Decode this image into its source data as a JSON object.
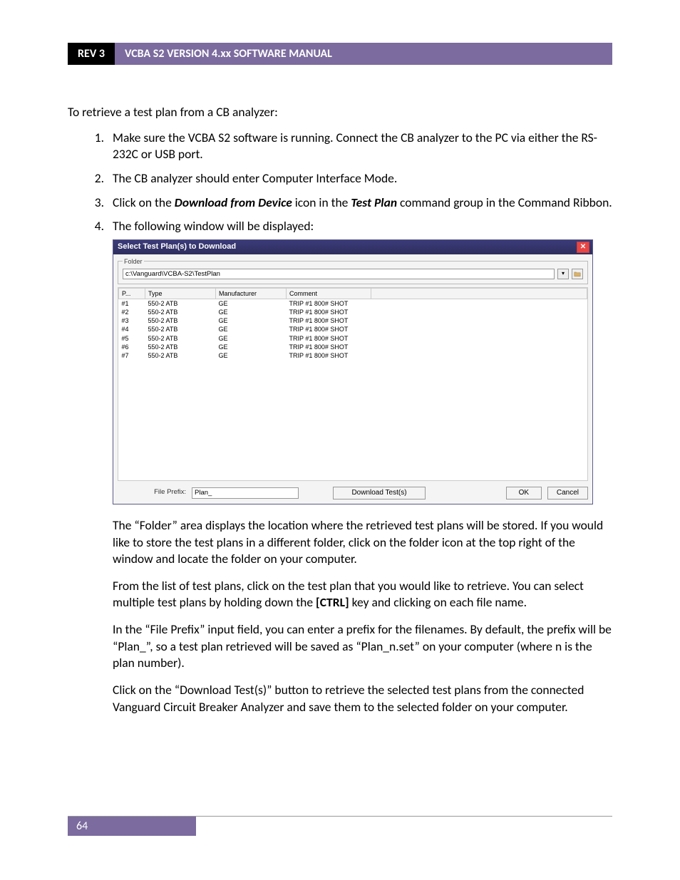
{
  "header": {
    "rev": "REV 3",
    "title": "VCBA S2 VERSION 4.xx SOFTWARE MANUAL"
  },
  "intro": "To retrieve a test plan from a CB analyzer:",
  "steps": {
    "s1": "Make sure the VCBA S2 software is running. Connect the CB analyzer to the PC via either the RS-232C or USB port.",
    "s2": "The CB analyzer should enter Computer Interface Mode.",
    "s3_a": "Click on the ",
    "s3_b": "Download from Device",
    "s3_c": " icon in the ",
    "s3_d": "Test Plan",
    "s3_e": " command group in the Command Ribbon.",
    "s4": "The following window will be displayed:"
  },
  "dialog": {
    "title": "Select Test Plan(s) to Download",
    "folder_legend": "Folder",
    "folder_path": "c:\\Vanguard\\VCBA-S2\\TestPlan",
    "columns": {
      "p": "P...",
      "type": "Type",
      "mfg": "Manufacturer",
      "comment": "Comment"
    },
    "rows": [
      {
        "p": "#1",
        "type": "550-2 ATB",
        "mfg": "GE",
        "comment": "TRIP #1 800# SHOT"
      },
      {
        "p": "#2",
        "type": "550-2 ATB",
        "mfg": "GE",
        "comment": "TRIP #1 800# SHOT"
      },
      {
        "p": "#3",
        "type": "550-2 ATB",
        "mfg": "GE",
        "comment": "TRIP #1 800# SHOT"
      },
      {
        "p": "#4",
        "type": "550-2 ATB",
        "mfg": "GE",
        "comment": "TRIP #1 800# SHOT"
      },
      {
        "p": "#5",
        "type": "550-2 ATB",
        "mfg": "GE",
        "comment": "TRIP #1 800# SHOT"
      },
      {
        "p": "#6",
        "type": "550-2 ATB",
        "mfg": "GE",
        "comment": "TRIP #1 800# SHOT"
      },
      {
        "p": "#7",
        "type": "550-2 ATB",
        "mfg": "GE",
        "comment": "TRIP #1 800# SHOT"
      }
    ],
    "file_prefix_label": "File Prefix:",
    "file_prefix_value": "Plan_",
    "download_btn": "Download Test(s)",
    "ok_btn": "OK",
    "cancel_btn": "Cancel"
  },
  "after": {
    "p1": "The “Folder” area displays the location where the retrieved test plans will be stored. If you would like to store the test plans in a different folder, click on the folder icon at the top right of the window and locate the folder on your computer.",
    "p2_a": "From the list of test plans, click on the test plan that you would like to retrieve. You can select multiple test plans by holding down the ",
    "p2_b": "[CTRL]",
    "p2_c": " key and clicking on each file name.",
    "p3": "In the “File Prefix” input field, you can enter a prefix for the filenames. By default, the prefix will be “Plan_”, so a test plan retrieved will be saved as “Plan_n.set” on your computer (where n is the plan number).",
    "p4": "Click on the “Download Test(s)” button to retrieve the selected test plans from the connected Vanguard Circuit Breaker Analyzer and save them to the selected folder on your computer."
  },
  "page_number": "64"
}
